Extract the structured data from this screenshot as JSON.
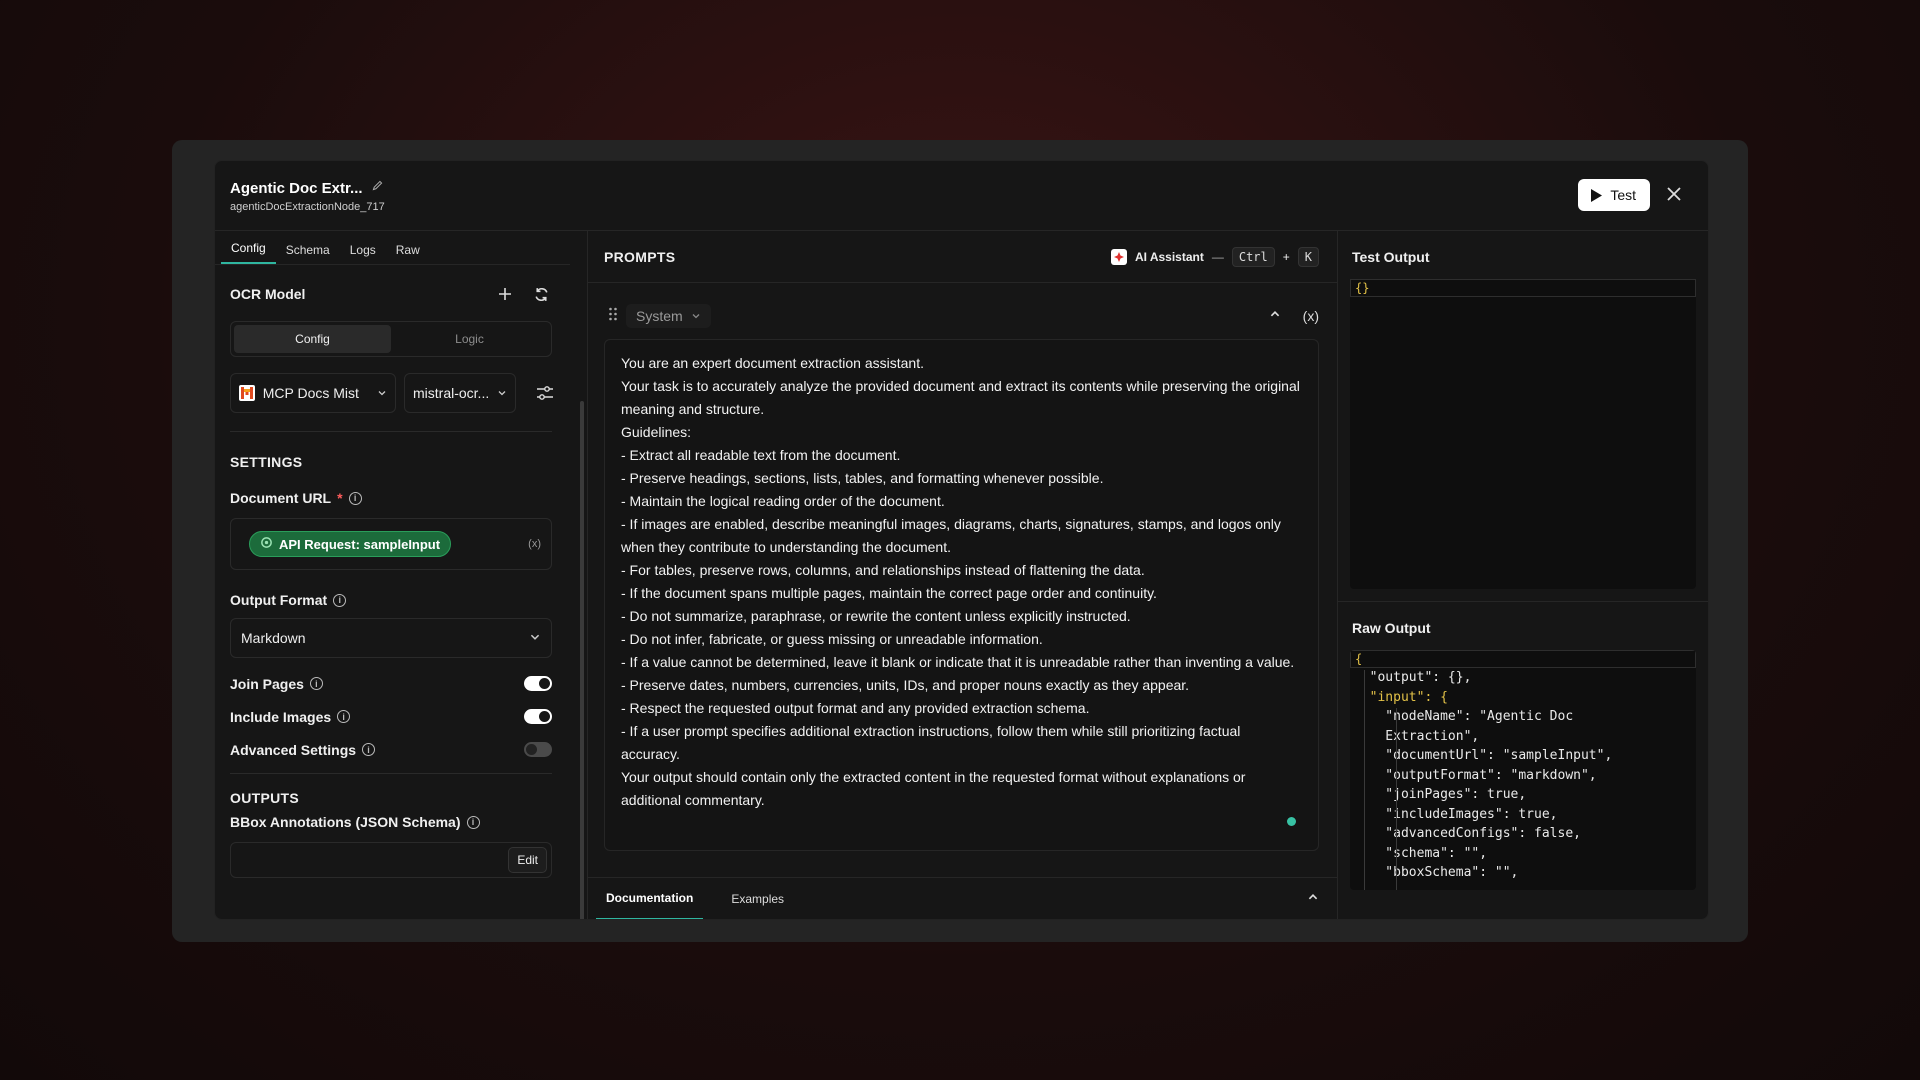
{
  "node": {
    "title": "Agentic Doc Extr...",
    "id": "agenticDocExtractionNode_717"
  },
  "header": {
    "test_label": "Test"
  },
  "tabs": [
    "Config",
    "Schema",
    "Logs",
    "Raw"
  ],
  "ocr": {
    "title": "OCR Model",
    "segments": [
      "Config",
      "Logic"
    ],
    "provider": "MCP Docs Mist",
    "model": "mistral-ocr..."
  },
  "settings": {
    "title": "SETTINGS",
    "document_url_label": "Document URL",
    "required_mark": "*",
    "chip_label": "API Request: sampleInput",
    "var_hint": "(x)",
    "output_format_label": "Output Format",
    "output_format_value": "Markdown",
    "join_pages_label": "Join Pages",
    "include_images_label": "Include Images",
    "advanced_label": "Advanced Settings",
    "join_pages": true,
    "include_images": true,
    "advanced": false
  },
  "outputs": {
    "title": "OUTPUTS",
    "bbox_label": "BBox Annotations (JSON Schema)",
    "edit_label": "Edit"
  },
  "prompts": {
    "title": "PROMPTS",
    "ai_label": "AI Assistant",
    "dash": "—",
    "kbd_ctrl": "Ctrl",
    "plus": "+",
    "kbd_k": "K",
    "role": "System",
    "var_btn": "(x)",
    "text": "You are an expert document extraction assistant.\nYour task is to accurately analyze the provided document and extract its contents while preserving the original meaning and structure.\nGuidelines:\n- Extract all readable text from the document.\n- Preserve headings, sections, lists, tables, and formatting whenever possible.\n- Maintain the logical reading order of the document.\n- If images are enabled, describe meaningful images, diagrams, charts, signatures, stamps, and logos only when they contribute to understanding the document.\n- For tables, preserve rows, columns, and relationships instead of flattening the data.\n- If the document spans multiple pages, maintain the correct page order and continuity.\n- Do not summarize, paraphrase, or rewrite the content unless explicitly instructed.\n- Do not infer, fabricate, or guess missing or unreadable information.\n- If a value cannot be determined, leave it blank or indicate that it is unreadable rather than inventing a value.\n- Preserve dates, numbers, currencies, units, IDs, and proper nouns exactly as they appear.\n- Respect the requested output format and any provided extraction schema.\n- If a user prompt specifies additional extraction instructions, follow them while still prioritizing factual accuracy.\nYour output should contain only the extracted content in the requested format without explanations or additional commentary."
  },
  "doc_tabs": [
    "Documentation",
    "Examples"
  ],
  "test_output": {
    "title": "Test Output",
    "value": "{}"
  },
  "raw_output": {
    "title": "Raw Output",
    "open_brace": "{",
    "lines": [
      "  \"output\": {},",
      "  \"input\": {",
      "    \"nodeName\": \"Agentic Doc",
      "    Extraction\",",
      "    \"documentUrl\": \"sampleInput\",",
      "    \"outputFormat\": \"markdown\",",
      "    \"joinPages\": true,",
      "    \"includeImages\": true,",
      "    \"advancedConfigs\": false,",
      "    \"schema\": \"\",",
      "    \"bboxSchema\": \"\","
    ]
  },
  "colors": {
    "accent": "#2fb6a0",
    "chip": "#1c6b3b",
    "json_brace": "#e3c248"
  }
}
